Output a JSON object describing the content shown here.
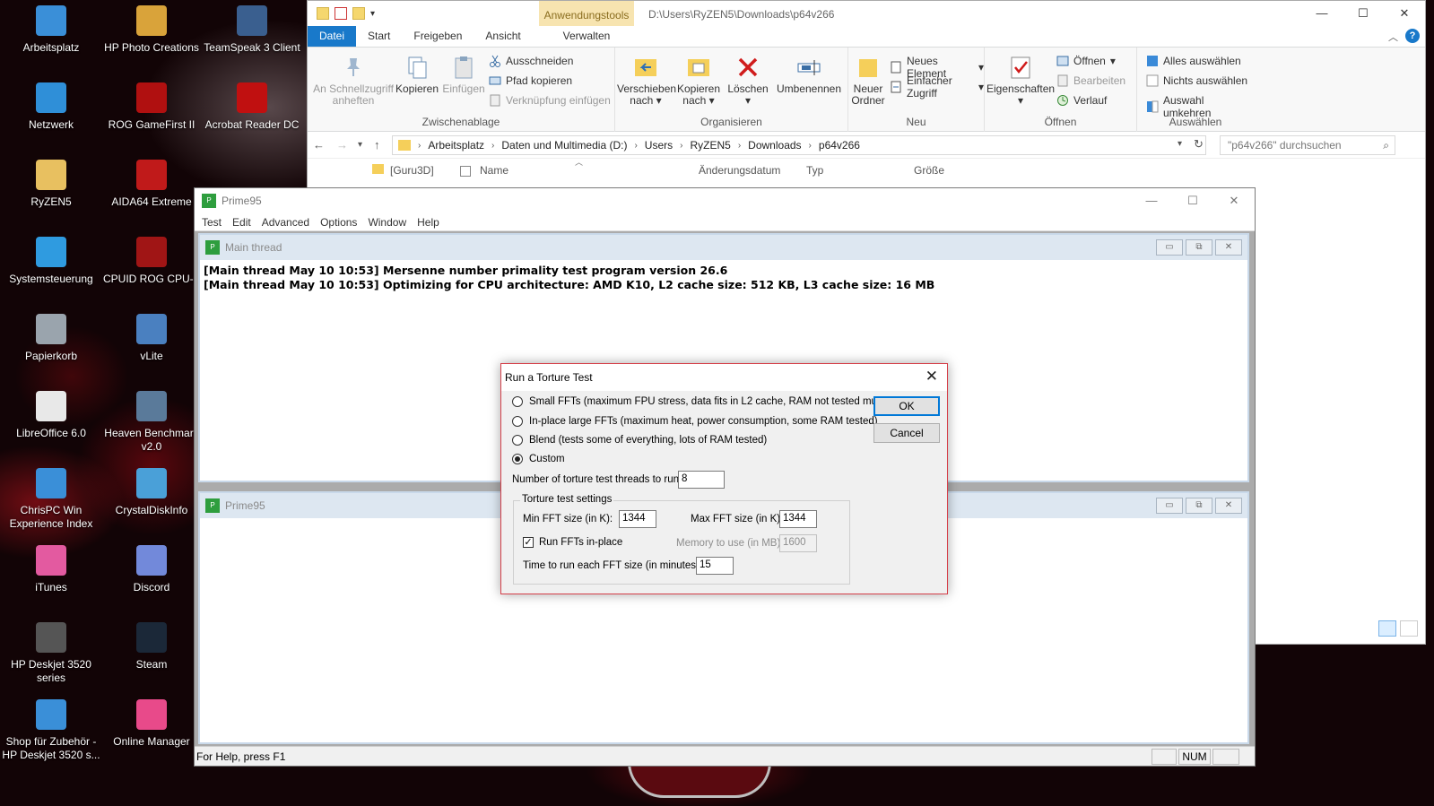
{
  "desktop": {
    "icons": [
      {
        "label": "Arbeitsplatz",
        "icon": "computer-icon",
        "color": "#3a8fd8"
      },
      {
        "label": "HP Photo Creations",
        "icon": "photo-icon",
        "color": "#d9a33a"
      },
      {
        "label": "TeamSpeak 3 Client",
        "icon": "teamspeak-icon",
        "color": "#3a5f8f"
      },
      {
        "label": "Netzwerk",
        "icon": "network-icon",
        "color": "#2f8fd8"
      },
      {
        "label": "ROG GameFirst II",
        "icon": "rog-icon",
        "color": "#b01010"
      },
      {
        "label": "Acrobat Reader DC",
        "icon": "acrobat-icon",
        "color": "#c01010"
      },
      {
        "label": "RyZEN5",
        "icon": "user-folder-icon",
        "color": "#e8c060"
      },
      {
        "label": "AIDA64 Extreme",
        "icon": "aida64-icon",
        "color": "#c01a1a"
      },
      {
        "label": "Systemsteuerung",
        "icon": "control-panel-icon",
        "color": "#2f9be0"
      },
      {
        "label": "CPUID ROG CPU-Z",
        "icon": "cpuz-icon",
        "color": "#a01515"
      },
      {
        "label": "Papierkorb",
        "icon": "recycle-bin-icon",
        "color": "#9aa4ad"
      },
      {
        "label": "vLite",
        "icon": "vlite-icon",
        "color": "#4a80c0"
      },
      {
        "label": "LibreOffice 6.0",
        "icon": "libreoffice-icon",
        "color": "#e8e8e8"
      },
      {
        "label": "Heaven Benchmark v2.0",
        "icon": "heaven-icon",
        "color": "#5a7a9a"
      },
      {
        "label": "ChrisPC Win Experience Index",
        "icon": "chrispc-icon",
        "color": "#3a8fd8"
      },
      {
        "label": "CrystalDiskInfo",
        "icon": "crystaldisk-icon",
        "color": "#4aa0d8"
      },
      {
        "label": "iTunes",
        "icon": "itunes-icon",
        "color": "#e35aa0"
      },
      {
        "label": "Discord",
        "icon": "discord-icon",
        "color": "#7289da"
      },
      {
        "label": "HP Deskjet 3520 series",
        "icon": "printer-icon",
        "color": "#555555"
      },
      {
        "label": "Steam",
        "icon": "steam-icon",
        "color": "#1b2838"
      },
      {
        "label": "Shop für Zubehör - HP Deskjet 3520 s...",
        "icon": "shop-icon",
        "color": "#3a8fd8"
      },
      {
        "label": "Online Manager",
        "icon": "online-manager-icon",
        "color": "#e84a8a"
      }
    ]
  },
  "explorer": {
    "app_tools_label": "Anwendungstools",
    "title_path": "D:\\Users\\RyZEN5\\Downloads\\p64v266",
    "tabs": [
      "Datei",
      "Start",
      "Freigeben",
      "Ansicht"
    ],
    "verwalten_tab": "Verwalten",
    "ribbon": {
      "clipboard": {
        "title": "Zwischenablage",
        "pin": "An Schnellzugriff anheften",
        "copy": "Kopieren",
        "paste": "Einfügen",
        "cut": "Ausschneiden",
        "copy_path": "Pfad kopieren",
        "paste_shortcut": "Verknüpfung einfügen"
      },
      "organize": {
        "title": "Organisieren",
        "move_to": "Verschieben nach",
        "copy_to": "Kopieren nach",
        "delete": "Löschen",
        "rename": "Umbenennen"
      },
      "new": {
        "title": "Neu",
        "new_folder": "Neuer Ordner",
        "new_item": "Neues Element",
        "easy_access": "Einfacher Zugriff"
      },
      "open": {
        "title": "Öffnen",
        "properties": "Eigenschaften",
        "open": "Öffnen",
        "edit": "Bearbeiten",
        "history": "Verlauf"
      },
      "select": {
        "title": "Auswählen",
        "select_all": "Alles auswählen",
        "select_none": "Nichts auswählen",
        "invert": "Auswahl umkehren"
      }
    },
    "breadcrumbs": [
      "Arbeitsplatz",
      "Daten und Multimedia (D:)",
      "Users",
      "RyZEN5",
      "Downloads",
      "p64v266"
    ],
    "search_placeholder": "\"p64v266\" durchsuchen",
    "nav_folder": "[Guru3D]",
    "columns": [
      "Name",
      "Änderungsdatum",
      "Typ",
      "Größe"
    ]
  },
  "prime95": {
    "title": "Prime95",
    "menu": [
      "Test",
      "Edit",
      "Advanced",
      "Options",
      "Window",
      "Help"
    ],
    "main_thread_title": "Main thread",
    "log_lines": [
      "[Main thread May 10 10:53] Mersenne number primality test program version 26.6",
      "[Main thread May 10 10:53] Optimizing for CPU architecture: AMD K10, L2 cache size: 512 KB, L3 cache size: 16 MB"
    ],
    "second_child_title": "Prime95",
    "status_text": "For Help, press F1",
    "status_num": "NUM"
  },
  "dialog": {
    "title": "Run a Torture Test",
    "options": [
      {
        "label": "Small FFTs (maximum FPU stress, data fits in L2 cache, RAM not tested much)",
        "selected": false
      },
      {
        "label": "In-place large FFTs (maximum heat, power consumption, some RAM tested)",
        "selected": false
      },
      {
        "label": "Blend (tests some of everything, lots of RAM tested)",
        "selected": false
      },
      {
        "label": "Custom",
        "selected": true
      }
    ],
    "ok": "OK",
    "cancel": "Cancel",
    "threads_label": "Number of torture test threads to run:",
    "threads_value": "8",
    "group_title": "Torture test settings",
    "min_fft_label": "Min FFT size (in K):",
    "min_fft_value": "1344",
    "max_fft_label": "Max FFT size (in K):",
    "max_fft_value": "1344",
    "run_inplace_label": "Run FFTs in-place",
    "run_inplace_checked": true,
    "memory_label": "Memory to use (in MB):",
    "memory_value": "1600",
    "time_label": "Time to run each FFT size (in minutes):",
    "time_value": "15"
  },
  "colors": {
    "accent_blue": "#1979ca",
    "dialog_border": "#d5404a",
    "app_tools_bg": "#f7e4b0"
  }
}
